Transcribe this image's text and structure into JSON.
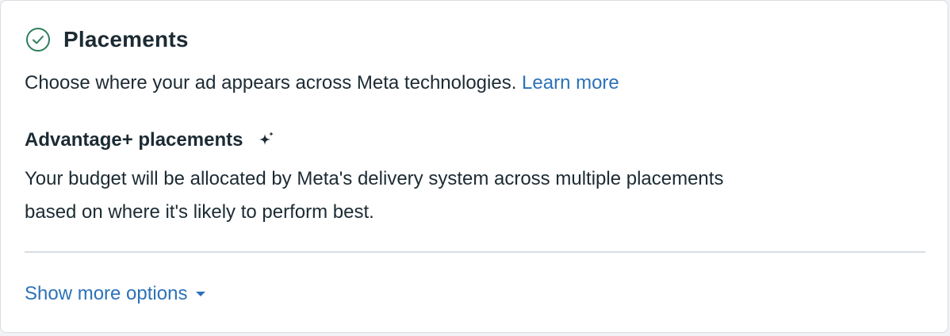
{
  "section": {
    "title": "Placements",
    "status_icon": "check-circle-icon",
    "description": "Choose where your ad appears across Meta technologies.",
    "learn_more_label": "Learn more"
  },
  "advantage": {
    "title": "Advantage+ placements",
    "icon": "sparkle-icon",
    "description": "Your budget will be allocated by Meta's delivery system across multiple placements based on where it's likely to perform best."
  },
  "footer": {
    "show_more_label": "Show more options",
    "icon": "caret-down-icon"
  },
  "colors": {
    "text": "#1c2b33",
    "link": "#2d72b8",
    "success": "#2e7d5b",
    "divider": "#dadde1"
  }
}
